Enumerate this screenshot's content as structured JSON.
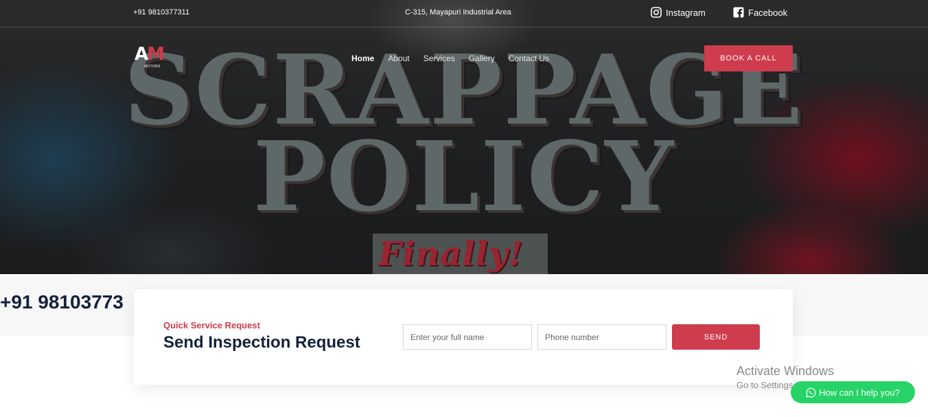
{
  "topbar": {
    "phone": "+91 9810377311",
    "address": "C-315, Mayapuri Industrial Area",
    "instagram_label": "Instagram",
    "facebook_label": "Facebook"
  },
  "logo": {
    "text_a": "A",
    "text_m": "M",
    "sub": "MOTORS"
  },
  "nav": {
    "items": [
      "Home",
      "About",
      "Services",
      "Gallery",
      "Contact Us"
    ],
    "active": "Home"
  },
  "book_button": "BOOK A CALL",
  "hero": {
    "line1": "SCRAPPAGE",
    "line2": "POLICY",
    "line3": "Finally!"
  },
  "marquee": "+91 98103773",
  "form": {
    "eyebrow": "Quick Service Request",
    "title": "Send Inspection Request",
    "name_placeholder": "Enter your full name",
    "phone_placeholder": "Phone number",
    "send_label": "SEND"
  },
  "overlay": {
    "activate_line1": "Activate Windows",
    "activate_line2": "Go to Settings to activate Windows."
  },
  "whatsapp": "How can I help you?",
  "colors": {
    "accent": "#cf3c4d",
    "navy": "#14213d",
    "whatsapp": "#25d366"
  }
}
